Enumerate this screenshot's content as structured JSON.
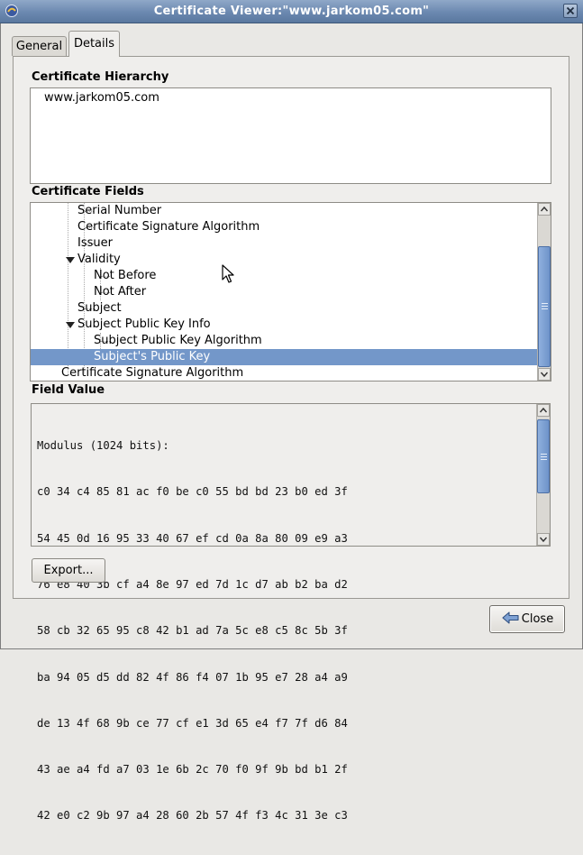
{
  "window": {
    "title": "Certificate Viewer:\"www.jarkom05.com\""
  },
  "tabs": {
    "general": "General",
    "details": "Details"
  },
  "hierarchy": {
    "label": "Certificate Hierarchy",
    "items": [
      "www.jarkom05.com"
    ]
  },
  "fields": {
    "label": "Certificate Fields",
    "rows": [
      {
        "text": "Serial Number",
        "selected": false
      },
      {
        "text": "Certificate Signature Algorithm",
        "selected": false
      },
      {
        "text": "Issuer",
        "selected": false
      },
      {
        "text": "Validity",
        "expanded": true,
        "selected": false
      },
      {
        "text": "Not Before",
        "selected": false
      },
      {
        "text": "Not After",
        "selected": false
      },
      {
        "text": "Subject",
        "selected": false
      },
      {
        "text": "Subject Public Key Info",
        "expanded": true,
        "selected": false
      },
      {
        "text": "Subject Public Key Algorithm",
        "selected": false
      },
      {
        "text": "Subject's Public Key",
        "selected": true
      },
      {
        "text": "Certificate Signature Algorithm",
        "selected": false
      }
    ]
  },
  "field_value": {
    "label": "Field Value",
    "lines": [
      "Modulus (1024 bits):",
      "c0 34 c4 85 81 ac f0 be c0 55 bd bd 23 b0 ed 3f",
      "54 45 0d 16 95 33 40 67 ef cd 0a 8a 80 09 e9 a3",
      "76 e8 40 3b cf a4 8e 97 ed 7d 1c d7 ab b2 ba d2",
      "58 cb 32 65 95 c8 42 b1 ad 7a 5c e8 c5 8c 5b 3f",
      "ba 94 05 d5 dd 82 4f 86 f4 07 1b 95 e7 28 a4 a9",
      "de 13 4f 68 9b ce 77 cf e1 3d 65 e4 f7 7f d6 84",
      "43 ae a4 fd a7 03 1e 6b 2c 70 f0 9f 9b bd b1 2f",
      "42 e0 c2 9b 97 a4 28 60 2b 57 4f f3 4c 31 3e c3"
    ]
  },
  "buttons": {
    "export": "Export...",
    "close": "Close"
  },
  "colors": {
    "selection": "#7397c9",
    "titlebar": "#6b88b0",
    "scroll_thumb": "#7a9dd0"
  }
}
